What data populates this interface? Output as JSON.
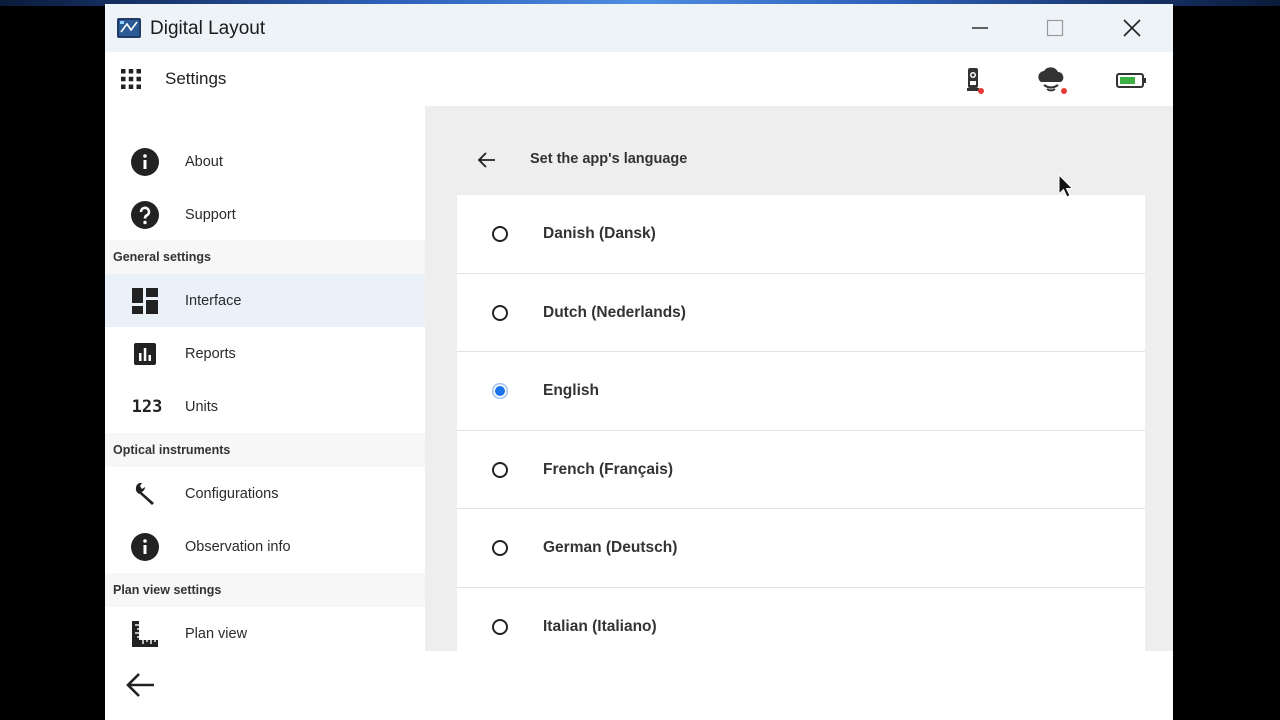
{
  "window": {
    "title": "Digital Layout",
    "controls": [
      "minimize",
      "maximize",
      "close"
    ]
  },
  "appbar": {
    "menu_icon": "apps-grid-icon",
    "title": "Settings",
    "status_icons": [
      {
        "name": "total-station-icon",
        "status_dot": "#e53935"
      },
      {
        "name": "cloud-sync-icon",
        "status_dot": "#e53935"
      },
      {
        "name": "battery-icon",
        "fill": "#3cb043"
      }
    ]
  },
  "sidebar": {
    "items": [
      {
        "label": "About",
        "icon": "info-icon"
      },
      {
        "label": "Support",
        "icon": "help-icon"
      },
      {
        "header": "General settings"
      },
      {
        "label": "Interface",
        "icon": "dashboard-icon",
        "active": true
      },
      {
        "label": "Reports",
        "icon": "bar-chart-icon"
      },
      {
        "label": "Units",
        "icon": "numbers-icon"
      },
      {
        "header": "Optical instruments"
      },
      {
        "label": "Configurations",
        "icon": "wrench-icon"
      },
      {
        "label": "Observation info",
        "icon": "info-icon"
      },
      {
        "header": "Plan view settings"
      },
      {
        "label": "Plan view",
        "icon": "ruler-icon"
      }
    ]
  },
  "content": {
    "title": "Set the app's language",
    "languages": [
      {
        "label": "Danish (Dansk)",
        "selected": false
      },
      {
        "label": "Dutch (Nederlands)",
        "selected": false
      },
      {
        "label": "English",
        "selected": true
      },
      {
        "label": "French (Français)",
        "selected": false
      },
      {
        "label": "German (Deutsch)",
        "selected": false
      },
      {
        "label": "Italian (Italiano)",
        "selected": false
      }
    ]
  },
  "colors": {
    "accent": "#1a73e8",
    "active_item_bg": "#eaf1f8",
    "content_bg": "#eeeeee",
    "titlebar_bg": "#eef3f8"
  }
}
